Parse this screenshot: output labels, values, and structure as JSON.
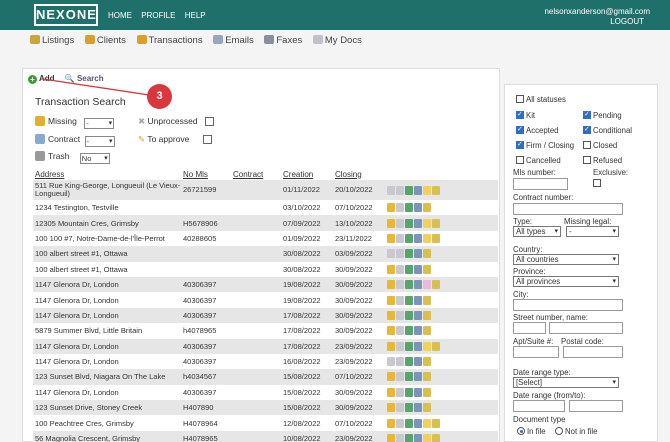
{
  "brand": "NEXONE",
  "topnav": [
    "HOME",
    "PROFILE",
    "HELP"
  ],
  "user": {
    "email": "nelsonxanderson@gmail.com",
    "logout": "LOGOUT"
  },
  "mainnav": [
    {
      "label": "Listings",
      "icon": "house-icon",
      "color": "#c9a53a"
    },
    {
      "label": "Clients",
      "icon": "clients-icon",
      "color": "#d9a030"
    },
    {
      "label": "Transactions",
      "icon": "transactions-icon",
      "color": "#d9a030"
    },
    {
      "label": "Emails",
      "icon": "email-icon",
      "color": "#9aa6c0"
    },
    {
      "label": "Faxes",
      "icon": "fax-icon",
      "color": "#8a8fa0"
    },
    {
      "label": "My Docs",
      "icon": "docs-icon",
      "color": "#c0c0c8"
    }
  ],
  "actions": {
    "add": "Add",
    "search": "Search"
  },
  "step_badge": "3",
  "heading": "Transaction Search",
  "filters": {
    "missing_label": "Missing",
    "missing_value": "-",
    "unprocessed_label": "Unprocessed",
    "contract_label": "Contract",
    "contract_value": "-",
    "to_approve_label": "To approve",
    "trash_label": "Trash",
    "trash_value": "No"
  },
  "columns": [
    "Address",
    "No Mls",
    "Contract",
    "Creation",
    "Closing"
  ],
  "rows": [
    {
      "address": "511 Rue King-George, Longueuil (Le Vieux-Longueuil)",
      "mls": "26721599",
      "contract": "",
      "creation": "01/11/2022",
      "closing": "20/10/2022"
    },
    {
      "address": "1234 Testington, Testville",
      "mls": "",
      "contract": "",
      "creation": "03/10/2022",
      "closing": "07/10/2022"
    },
    {
      "address": "12305 Mountain Cres, Grimsby",
      "mls": "H5678906",
      "contract": "",
      "creation": "07/09/2022",
      "closing": "13/10/2022"
    },
    {
      "address": "100 100 #7, Notre-Dame-de-l'Île-Perrot",
      "mls": "40288605",
      "contract": "",
      "creation": "01/09/2022",
      "closing": "23/11/2022"
    },
    {
      "address": "100 albert street #1, Ottawa",
      "mls": "",
      "contract": "",
      "creation": "30/08/2022",
      "closing": "03/09/2022"
    },
    {
      "address": "100 albert street #1, Ottawa",
      "mls": "",
      "contract": "",
      "creation": "30/08/2022",
      "closing": "30/09/2022"
    },
    {
      "address": "1147 Glenora Dr, London",
      "mls": "40306397",
      "contract": "",
      "creation": "19/08/2022",
      "closing": "30/09/2022"
    },
    {
      "address": "1147 Glenora Dr, London",
      "mls": "40306397",
      "contract": "",
      "creation": "19/08/2022",
      "closing": "30/09/2022"
    },
    {
      "address": "1147 Glenora Dr, London",
      "mls": "40306397",
      "contract": "",
      "creation": "17/08/2022",
      "closing": "30/09/2022"
    },
    {
      "address": "5879 Summer Blvd, Little Britain",
      "mls": "h4078965",
      "contract": "",
      "creation": "17/08/2022",
      "closing": "30/09/2022"
    },
    {
      "address": "1147 Glenora Dr, London",
      "mls": "40306397",
      "contract": "",
      "creation": "17/08/2022",
      "closing": "23/09/2022"
    },
    {
      "address": "1147 Glenora Dr, London",
      "mls": "40306397",
      "contract": "",
      "creation": "16/08/2022",
      "closing": "23/09/2022"
    },
    {
      "address": "123 Sunset Blvd, Niagara On The Lake",
      "mls": "h4034567",
      "contract": "",
      "creation": "15/08/2022",
      "closing": "07/10/2022"
    },
    {
      "address": "1147 Glenora Dr, London",
      "mls": "40306397",
      "contract": "",
      "creation": "15/08/2022",
      "closing": "30/09/2022"
    },
    {
      "address": "123 Sunset Drive, Stoney Creek",
      "mls": "H407890",
      "contract": "",
      "creation": "15/08/2022",
      "closing": "30/09/2022"
    },
    {
      "address": "100 Peachtree Cres, Grimsby",
      "mls": "H4078964",
      "contract": "",
      "creation": "12/08/2022",
      "closing": "07/10/2022"
    },
    {
      "address": "56 Magnolia Crescent, Grimsby",
      "mls": "H4078965",
      "contract": "",
      "creation": "10/08/2022",
      "closing": "23/09/2022"
    }
  ],
  "sidebar": {
    "all_statuses": "All statuses",
    "kit": "Kit",
    "pending": "Pending",
    "accepted": "Accepted",
    "conditional": "Conditional",
    "firm_closing": "Firm / Closing",
    "closed": "Closed",
    "cancelled": "Cancelled",
    "refused": "Refused",
    "mls_number": "Mls number:",
    "exclusive": "Exclusive:",
    "contract_number": "Contract number:",
    "type": "Type:",
    "type_value": "All types",
    "missing_legal": "Missing legal:",
    "missing_legal_value": "-",
    "country": "Country:",
    "country_value": "All countries",
    "province": "Province:",
    "province_value": "All provinces",
    "city": "City:",
    "street": "Street number, name:",
    "apt": "Apt/Suite #:",
    "postal": "Postal code:",
    "date_range_type": "Date range type:",
    "date_range_value": "[Select]",
    "date_range": "Date range (from/to):",
    "document_type": "Document type",
    "in_file": "In file",
    "not_in_file": "Not in file"
  }
}
